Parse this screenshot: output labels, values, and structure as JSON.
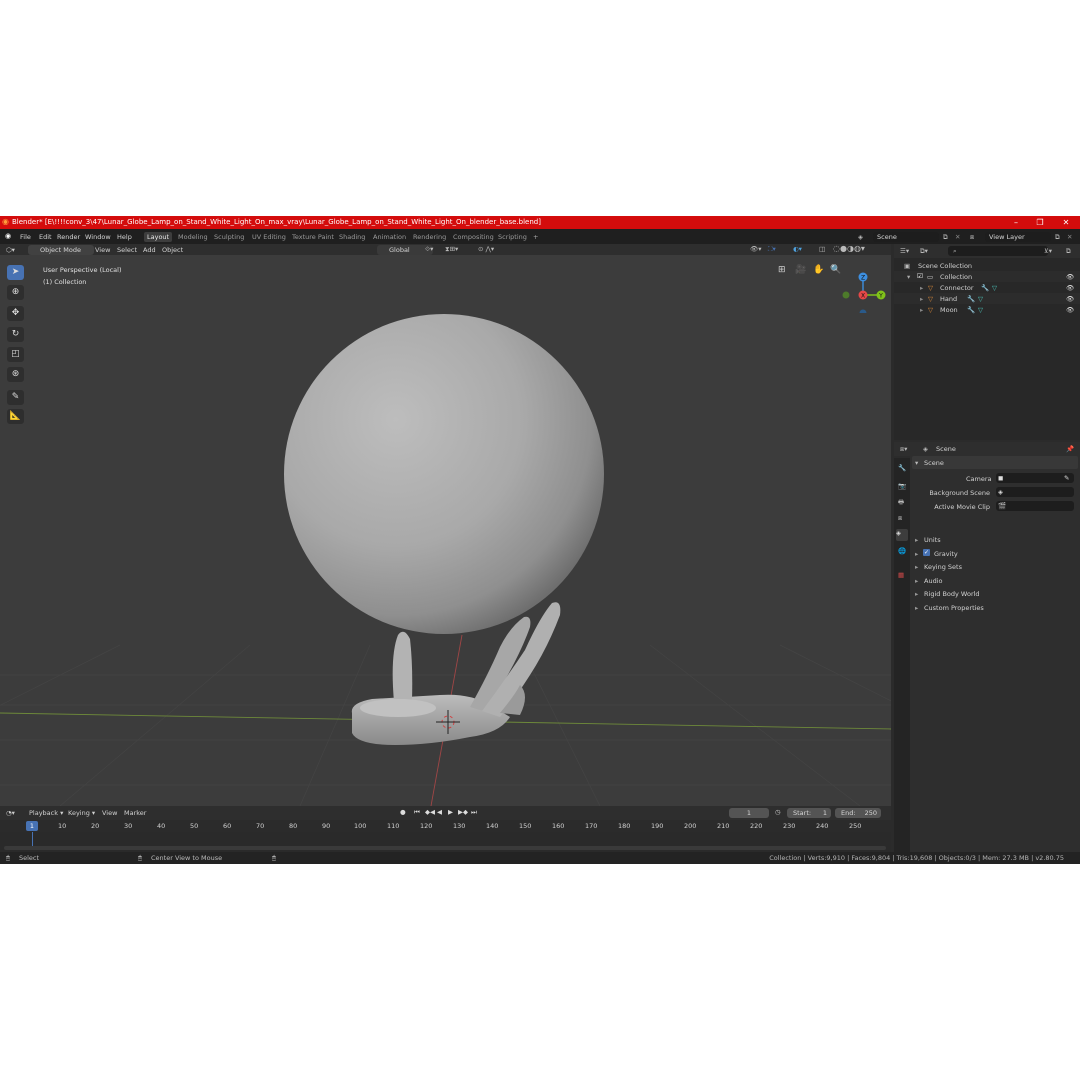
{
  "window": {
    "title": "Blender* [E\\!!!!conv_3\\47\\Lunar_Globe_Lamp_on_Stand_White_Light_On_max_vray\\Lunar_Globe_Lamp_on_Stand_White_Light_On_blender_base.blend]",
    "minimize": "–",
    "maximize": "❐",
    "close": "✕"
  },
  "menu": [
    "File",
    "Edit",
    "Render",
    "Window",
    "Help"
  ],
  "workspaces": [
    "Layout",
    "Modeling",
    "Sculpting",
    "UV Editing",
    "Texture Paint",
    "Shading",
    "Animation",
    "Rendering",
    "Compositing",
    "Scripting"
  ],
  "active_workspace": "Layout",
  "add_workspace": "+",
  "scene_selector": {
    "value": "Scene"
  },
  "viewlayer_selector": {
    "value": "View Layer"
  },
  "viewport_header": {
    "mode": "Object Mode",
    "menus": [
      "View",
      "Select",
      "Add",
      "Object"
    ],
    "transform_orientation": "Global"
  },
  "viewport": {
    "perspective_label": "User Perspective (Local)",
    "collection_label": "(1) Collection",
    "gizmo": {
      "z": "Z",
      "x": "X",
      "y": "Y"
    }
  },
  "outliner": {
    "search_placeholder": "",
    "root": "Scene Collection",
    "collection": "Collection",
    "objects": [
      "Connector",
      "Hand",
      "Moon"
    ]
  },
  "properties": {
    "context": "Scene",
    "panel": "Scene",
    "fields": [
      {
        "label": "Camera",
        "value": ""
      },
      {
        "label": "Background Scene",
        "value": ""
      },
      {
        "label": "Active Movie Clip",
        "value": ""
      }
    ],
    "subpanels": [
      "Units",
      "Gravity",
      "Keying Sets",
      "Audio",
      "Rigid Body World",
      "Custom Properties"
    ],
    "gravity_checked": true
  },
  "timeline": {
    "menus": [
      "Playback",
      "Keying",
      "View",
      "Marker"
    ],
    "current_frame": "1",
    "start_label": "Start:",
    "start": "1",
    "end_label": "End:",
    "end": "250",
    "ruler": [
      "1",
      "10",
      "20",
      "30",
      "40",
      "50",
      "60",
      "70",
      "80",
      "90",
      "100",
      "110",
      "120",
      "130",
      "140",
      "150",
      "160",
      "170",
      "180",
      "190",
      "200",
      "210",
      "220",
      "230",
      "240",
      "250"
    ]
  },
  "statusbar": {
    "select": "Select",
    "center_view": "Center View to Mouse",
    "stats": "Collection | Verts:9,910 | Faces:9,804 | Tris:19,608 | Objects:0/3 | Mem: 27.3 MB | v2.80.75"
  },
  "colors": {
    "title_bar": "#d40c0c",
    "active_tool": "#4772b3",
    "object_icon": "#e8913b",
    "axis_x": "#e64747",
    "axis_y": "#80c21a",
    "axis_z": "#3d8fe0"
  }
}
